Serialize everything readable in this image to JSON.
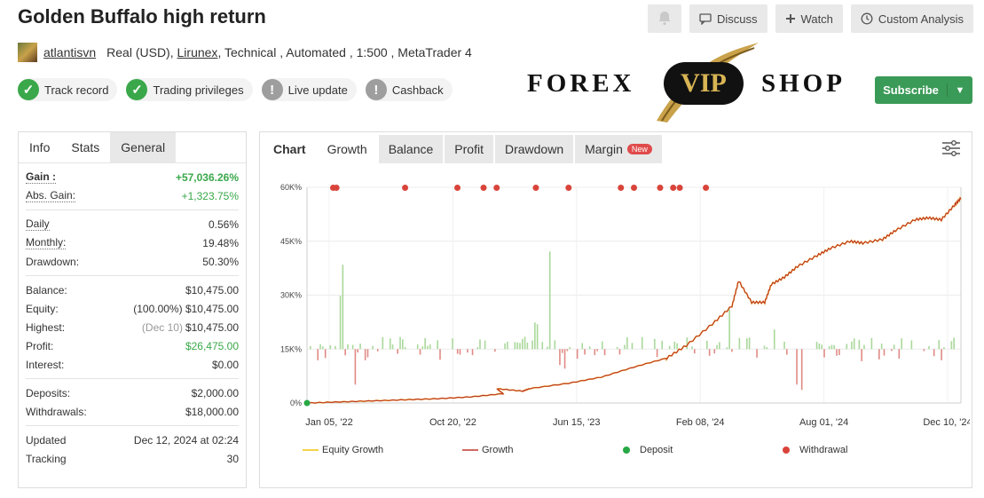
{
  "header": {
    "title": "Golden Buffalo high return",
    "buttons": {
      "discuss": "Discuss",
      "watch": "Watch",
      "custom_analysis": "Custom Analysis"
    }
  },
  "account": {
    "username": "atlantisvn",
    "type": "Real (USD),",
    "broker": "Lirunex",
    "rest": ", Technical , Automated , 1:500 , MetaTrader 4"
  },
  "badges": [
    {
      "label": "Track record",
      "status": "ok"
    },
    {
      "label": "Trading privileges",
      "status": "ok"
    },
    {
      "label": "Live update",
      "status": "no"
    },
    {
      "label": "Cashback",
      "status": "no"
    }
  ],
  "logo": {
    "left": "FOREX",
    "middle": "VIP",
    "right": "SHOP"
  },
  "subscribe": {
    "label": "Subscribe"
  },
  "stats_tabs": [
    "Info",
    "Stats",
    "General"
  ],
  "stats": {
    "gain_label": "Gain :",
    "gain": "+57,036.26%",
    "abs_gain_label": "Abs. Gain:",
    "abs_gain": "+1,323.75%",
    "daily_label": "Daily",
    "daily": "0.56%",
    "monthly_label": "Monthly:",
    "monthly": "19.48%",
    "drawdown_label": "Drawdown:",
    "drawdown": "50.30%",
    "balance_label": "Balance:",
    "balance": "$10,475.00",
    "equity_label": "Equity:",
    "equity_pct": "(100.00%)",
    "equity": "$10,475.00",
    "highest_label": "Highest:",
    "highest_date": "(Dec 10)",
    "highest": "$10,475.00",
    "profit_label": "Profit:",
    "profit": "$26,475.00",
    "interest_label": "Interest:",
    "interest": "$0.00",
    "deposits_label": "Deposits:",
    "deposits": "$2,000.00",
    "withdrawals_label": "Withdrawals:",
    "withdrawals": "$18,000.00",
    "updated_label": "Updated",
    "updated": "Dec 12, 2024 at 02:24",
    "tracking_label": "Tracking",
    "tracking": "30"
  },
  "chart_tabs": {
    "chart": "Chart",
    "growth": "Growth",
    "balance": "Balance",
    "profit": "Profit",
    "drawdown": "Drawdown",
    "margin": "Margin",
    "new_badge": "New"
  },
  "chart_data": {
    "type": "line",
    "title": "",
    "ylabel": "",
    "xlabel": "",
    "y_ticks": [
      "0%",
      "15K%",
      "30K%",
      "45K%",
      "60K%"
    ],
    "x_ticks": [
      "Jan 05, '22",
      "Oct 20, '22",
      "Jun 15, '23",
      "Feb 08, '24",
      "Aug 01, '24",
      "Dec 10, '24"
    ],
    "ylim": [
      0,
      60000
    ],
    "growth_points": [
      [
        0,
        0
      ],
      [
        0.05,
        300
      ],
      [
        0.1,
        600
      ],
      [
        0.15,
        900
      ],
      [
        0.2,
        1200
      ],
      [
        0.25,
        1700
      ],
      [
        0.3,
        2600
      ],
      [
        0.29,
        4000
      ],
      [
        0.33,
        3300
      ],
      [
        0.34,
        4000
      ],
      [
        0.4,
        5500
      ],
      [
        0.45,
        7200
      ],
      [
        0.5,
        10000
      ],
      [
        0.55,
        12500
      ],
      [
        0.58,
        16000
      ],
      [
        0.62,
        22000
      ],
      [
        0.65,
        27000
      ],
      [
        0.66,
        34000
      ],
      [
        0.68,
        28000
      ],
      [
        0.7,
        28000
      ],
      [
        0.71,
        33000
      ],
      [
        0.73,
        35000
      ],
      [
        0.75,
        38000
      ],
      [
        0.78,
        41000
      ],
      [
        0.8,
        43000
      ],
      [
        0.83,
        45000
      ],
      [
        0.85,
        44500
      ],
      [
        0.88,
        45500
      ],
      [
        0.9,
        48000
      ],
      [
        0.93,
        51000
      ],
      [
        0.95,
        51500
      ],
      [
        0.97,
        51000
      ],
      [
        0.99,
        55000
      ],
      [
        1.0,
        57000
      ]
    ],
    "withdrawal_markers": [
      0.04,
      0.045,
      0.15,
      0.23,
      0.27,
      0.29,
      0.35,
      0.4,
      0.48,
      0.5,
      0.54,
      0.56,
      0.57,
      0.61
    ],
    "deposit_marker": 0,
    "legend": [
      "Equity Growth",
      "Growth",
      "Deposit",
      "Withdrawal"
    ],
    "colors": {
      "equity": "#f2c40f",
      "growth": "#c0392b",
      "deposit": "#27a844",
      "withdrawal": "#d9443a",
      "bar_pos": "#a9d89a",
      "bar_neg": "#e08a84"
    }
  }
}
